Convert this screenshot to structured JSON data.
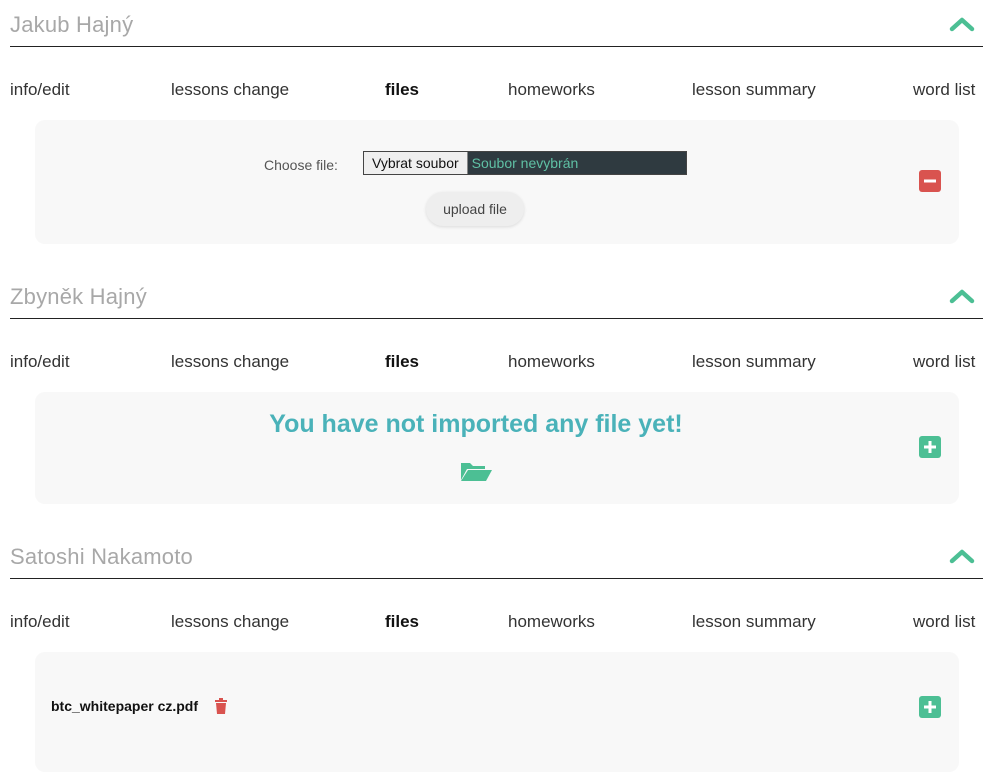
{
  "students": [
    {
      "name": "Jakub Hajný",
      "tabs": [
        "info/edit",
        "lessons change",
        "files",
        "homeworks",
        "lesson summary",
        "word list"
      ],
      "upload": {
        "choose_label": "Choose file:",
        "file_button": "Vybrat soubor",
        "file_status": "Soubor nevybrán",
        "upload_button": "upload file"
      }
    },
    {
      "name": "Zbyněk Hajný",
      "tabs": [
        "info/edit",
        "lessons change",
        "files",
        "homeworks",
        "lesson summary",
        "word list"
      ],
      "empty_message": "You have not imported any file yet!"
    },
    {
      "name": "Satoshi Nakamoto",
      "tabs": [
        "info/edit",
        "lessons change",
        "files",
        "homeworks",
        "lesson summary",
        "word list"
      ],
      "files": [
        "btc_whitepaper cz.pdf"
      ]
    }
  ],
  "active_tab": "files",
  "colors": {
    "accent_green": "#4cbf94",
    "empty_text": "#4ab2b9",
    "danger_red": "#d9534f"
  }
}
